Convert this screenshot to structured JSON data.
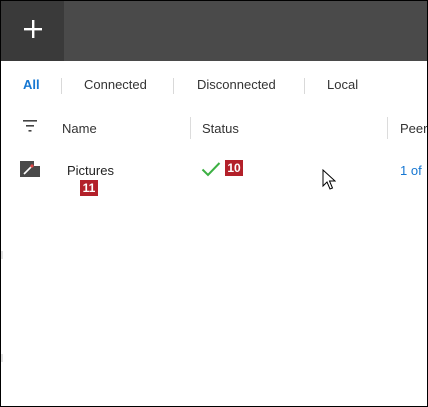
{
  "toolbar": {
    "add_glyph": "+",
    "add_icon": "plus-icon"
  },
  "filters": {
    "tabs": [
      {
        "label": "All",
        "active": true
      },
      {
        "label": "Connected",
        "active": false
      },
      {
        "label": "Disconnected",
        "active": false
      },
      {
        "label": "Local",
        "active": false
      }
    ]
  },
  "table": {
    "columns": {
      "name": "Name",
      "status": "Status",
      "peers": "Peer"
    },
    "rows": [
      {
        "name": "Pictures",
        "status_icon": "checkmark-icon",
        "peers": "1 of"
      }
    ]
  },
  "badges": {
    "status": "10",
    "name": "11"
  },
  "colors": {
    "accent": "#1677d2",
    "success": "#3cb043",
    "badge": "#b3202a",
    "topbar": "#4a4a4a"
  }
}
